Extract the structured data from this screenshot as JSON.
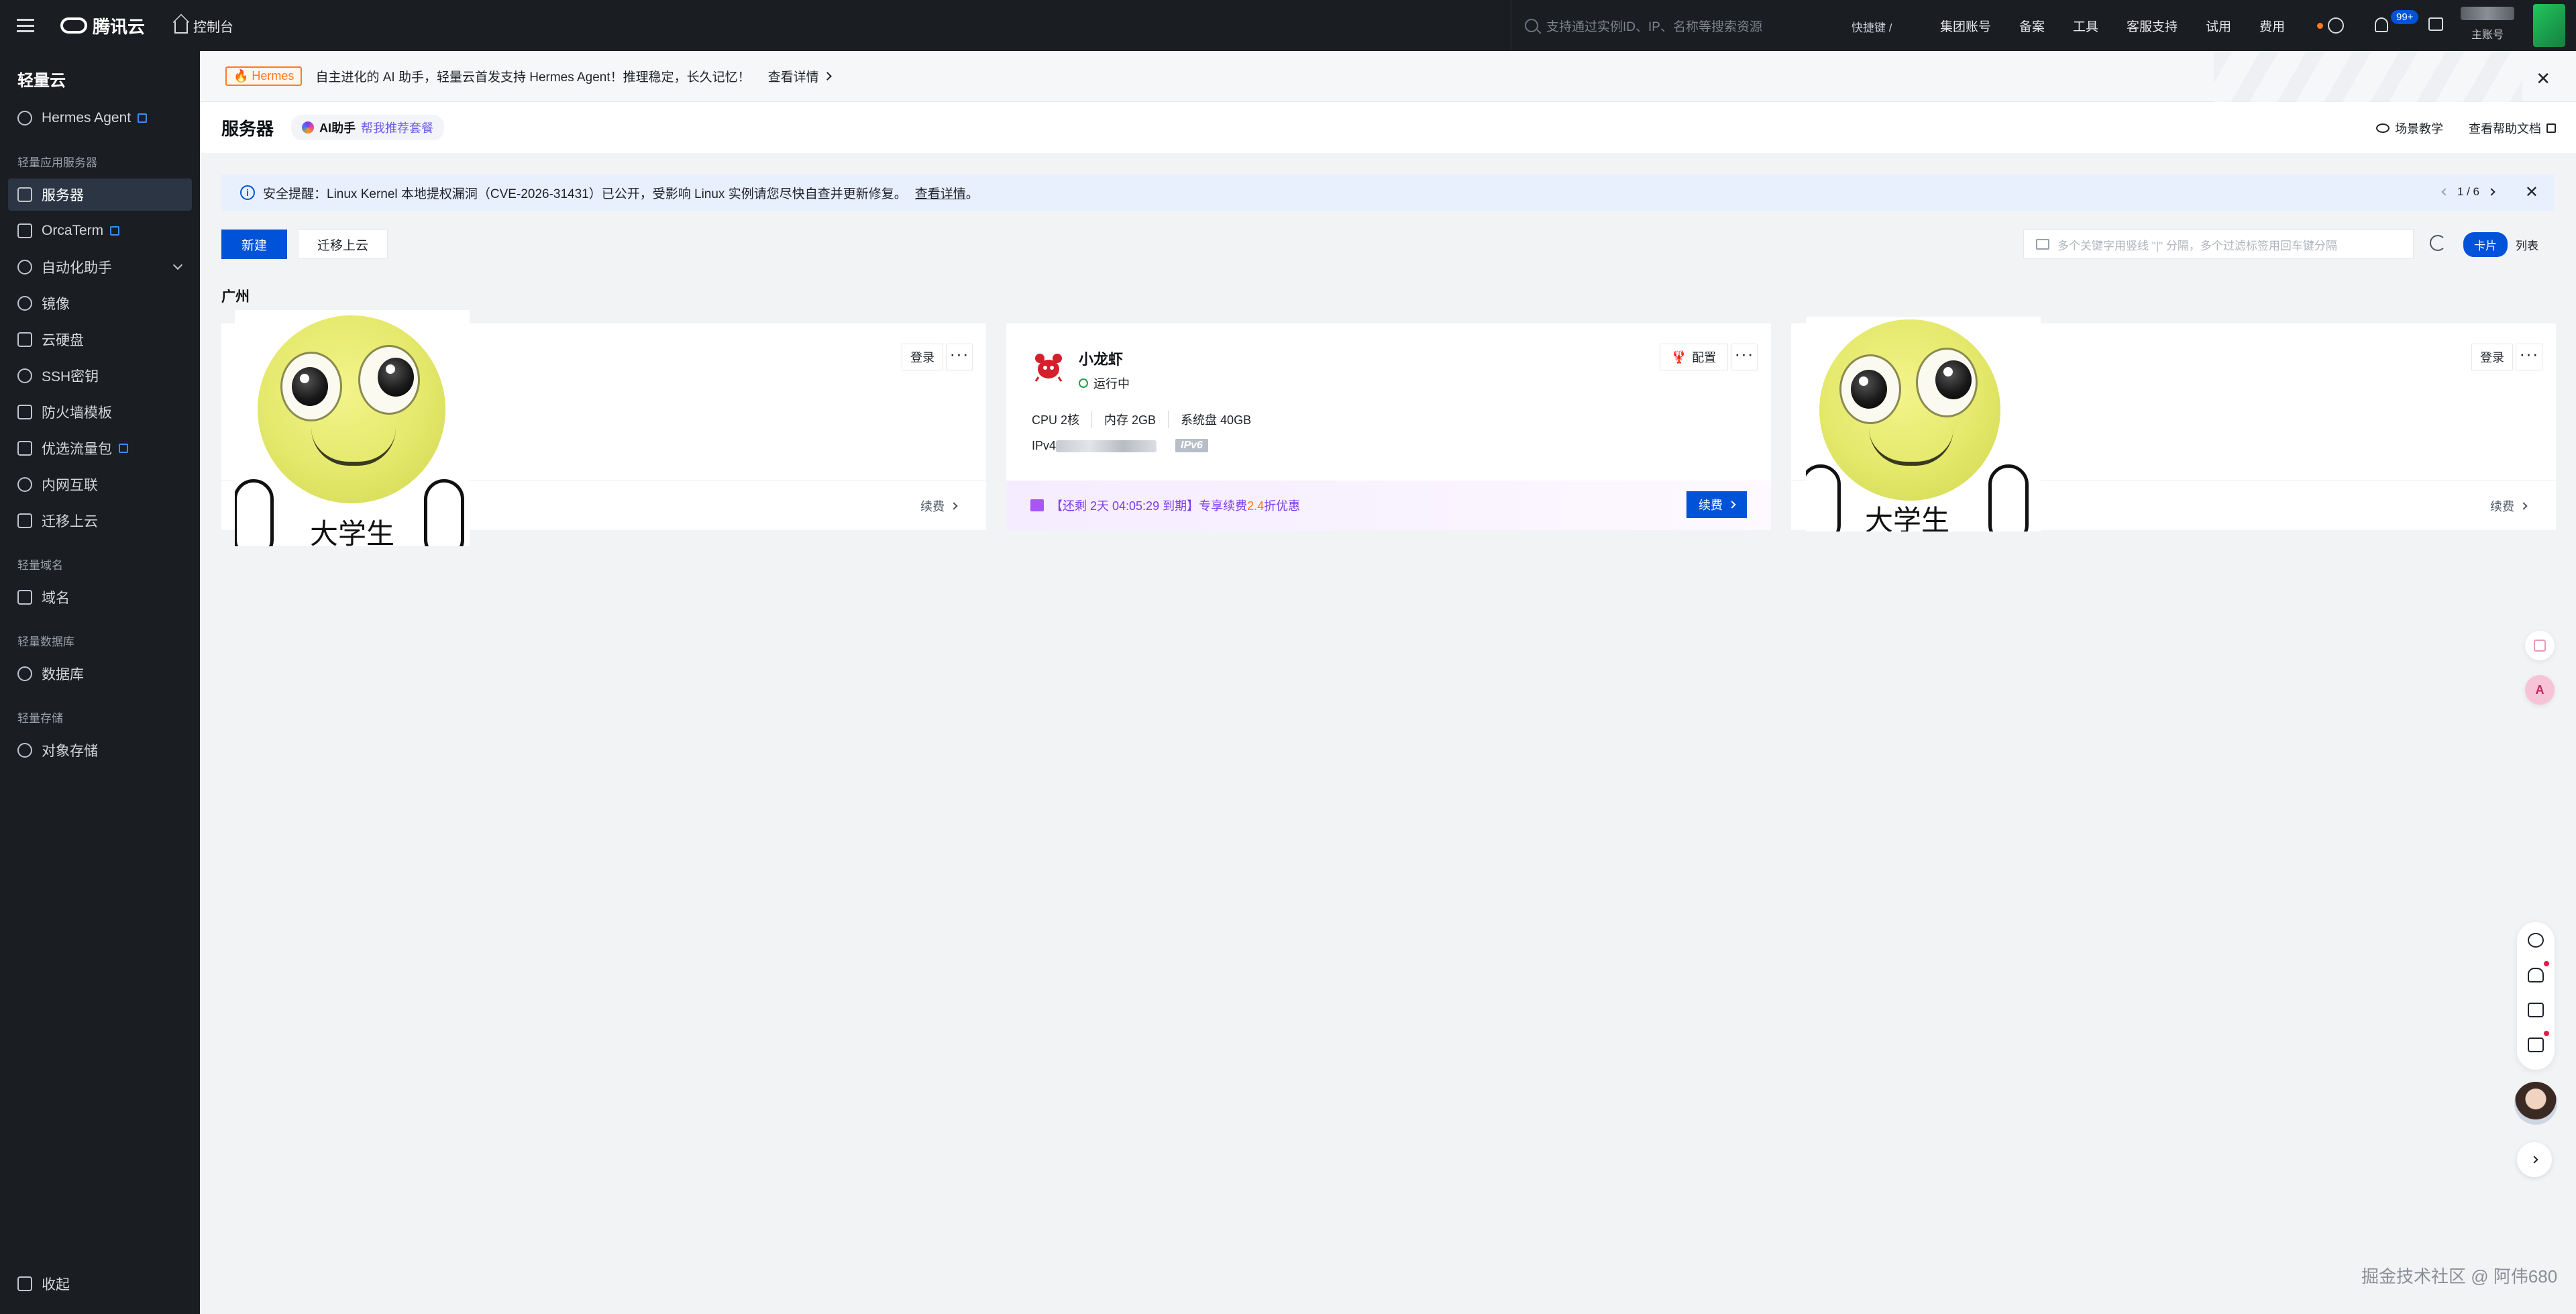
{
  "topbar": {
    "brand": "腾讯云",
    "console": "控制台",
    "search_placeholder": "支持通过实例ID、IP、名称等搜索资源",
    "shortcut": "快捷键 /",
    "nav": [
      "集团账号",
      "备案",
      "工具",
      "客服支持",
      "试用",
      "费用"
    ],
    "notification_badge": "99+",
    "account_label": "主账号"
  },
  "sidebar": {
    "title": "轻量云",
    "hermes": "Hermes Agent",
    "group_server": "轻量应用服务器",
    "items": [
      {
        "label": "服务器",
        "icon": "server-icon"
      },
      {
        "label": "OrcaTerm",
        "icon": "terminal-icon"
      },
      {
        "label": "自动化助手",
        "icon": "rocket-icon"
      },
      {
        "label": "镜像",
        "icon": "disc-icon"
      },
      {
        "label": "云硬盘",
        "icon": "disk-icon"
      },
      {
        "label": "SSH密钥",
        "icon": "key-icon"
      },
      {
        "label": "防火墙模板",
        "icon": "shield-icon"
      },
      {
        "label": "优选流量包",
        "icon": "traffic-icon"
      },
      {
        "label": "内网互联",
        "icon": "link-icon"
      },
      {
        "label": "迁移上云",
        "icon": "migrate-icon"
      }
    ],
    "group_domain": "轻量域名",
    "domain": "域名",
    "group_db": "轻量数据库",
    "database": "数据库",
    "group_storage": "轻量存储",
    "storage": "对象存储",
    "collapse": "收起"
  },
  "banner": {
    "tag": "Hermes",
    "text": "自主进化的 AI 助手，轻量云首发支持 Hermes Agent！推理稳定，长久记忆！",
    "link": "查看详情"
  },
  "page": {
    "title": "服务器",
    "ai_label": "AI助手",
    "ai_link": "帮我推荐套餐",
    "scene_teach": "场景教学",
    "help_docs": "查看帮助文档"
  },
  "notice": {
    "text": "安全提醒：Linux Kernel 本地提权漏洞（CVE-2026-31431）已公开，受影响 Linux 实例请您尽快自查并更新修复。",
    "link": "查看详情",
    "suffix": "。",
    "pager": "1 / 6"
  },
  "toolbar": {
    "new": "新建",
    "migrate": "迁移上云",
    "filter_placeholder": "多个关键字用竖线 \"|\" 分隔，多个过滤标签用回车键分隔",
    "view_card": "卡片",
    "view_list": "列表"
  },
  "region": "广州",
  "cards": [
    {
      "login": "登录",
      "renew": "续费",
      "sticker_text": "大学生"
    },
    {
      "name": "小龙虾",
      "status": "运行中",
      "config": "配置",
      "specs": [
        "CPU 2核",
        "内存 2GB",
        "系统盘 40GB"
      ],
      "ipv4_label": "IPv4",
      "ipv6_tag": "IPv6",
      "promo_prefix": "【还剩 2天 04:05:29 到期】专享续费",
      "promo_discount": "2.4",
      "promo_suffix": "折优惠",
      "promo_button": "续费"
    },
    {
      "login": "登录",
      "renew": "续费",
      "sticker_text": "大学生"
    }
  ],
  "watermark": "掘金技术社区 @ 阿伟680",
  "colors": {
    "primary": "#0052d9",
    "sidebar_bg": "#1a1d21",
    "accent_orange": "#ff7a21",
    "promo_purple": "#7c3aed"
  }
}
